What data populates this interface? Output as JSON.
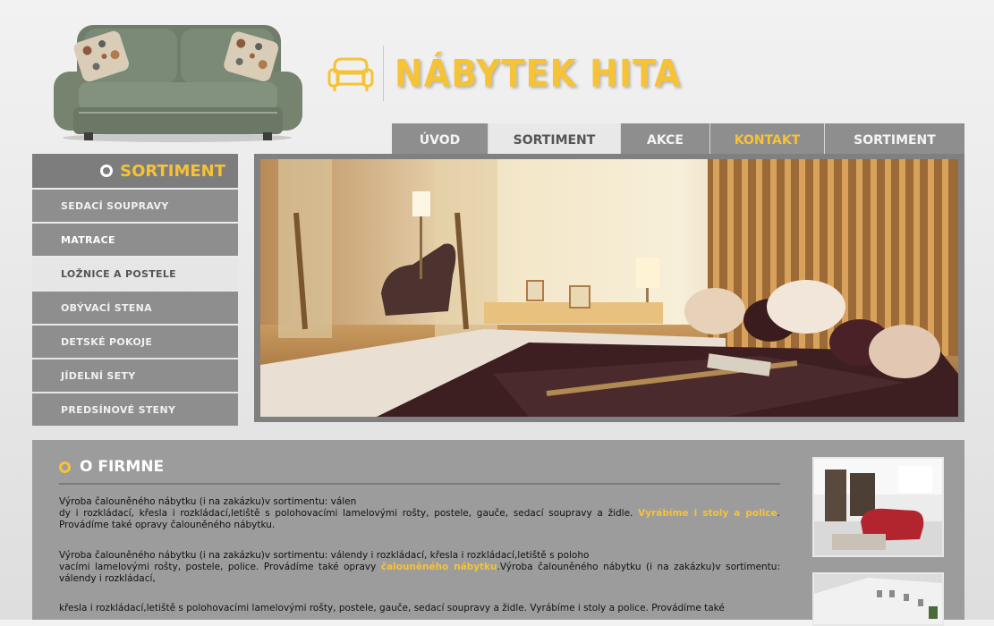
{
  "header": {
    "logo_text": "NÁBYTEK HITA",
    "colors": {
      "accent": "#f6c236",
      "nav": "#8e8e8e",
      "panel": "#9c9c9c"
    }
  },
  "topnav": {
    "tabs": [
      {
        "label": "ÚVOD"
      },
      {
        "label": "SORTIMENT"
      },
      {
        "label": "AKCE"
      },
      {
        "label": "KONTAKT"
      },
      {
        "label": "SORTIMENT"
      }
    ]
  },
  "sidebar": {
    "title": "SORTIMENT",
    "items": [
      {
        "label": "SEDACÍ SOUPRAVY"
      },
      {
        "label": "MATRACE"
      },
      {
        "label": "LOŽNICE A POSTELE"
      },
      {
        "label": "OBÝVACÍ STENA"
      },
      {
        "label": "DETSKÉ POKOJE"
      },
      {
        "label": "JÍDELNÍ SETY"
      },
      {
        "label": "PREDSÍNOVÉ STENY"
      }
    ]
  },
  "about": {
    "title": "O FIRMNE",
    "p1_a": "Výroba čalouněného nábytku (i na zakázku)v sortimentu: válen",
    "p1_b": "dy i rozkládací, křesla i rozkládací,letiště s polohovacími lamelovými rošty, postele, gauče, sedací soupravy a židle. ",
    "p1_hl": "Vyrábíme i stoly a police",
    "p1_c": ". Provádíme také opravy čalouněného nábytku.",
    "p2_a": "Výroba čalouněného nábytku (i na zakázku)v sortimentu: válendy i rozkládací, křesla i rozkládací,letiště s poloho",
    "p2_b": "vacími lamelovými rošty, postele, police. Provádíme také opravy ",
    "p2_hl": "čalouněného nábytku",
    "p2_c": ".Výroba čalouněného nábytku (i na zakázku)v sortimentu: válendy i rozkládací,",
    "p3_a": "křesla i rozkládací,letiště s polohovacími lamelovými rošty, postele, gauče, sedací soupravy a židle. Vyrábíme i stoly a police. Provádíme také"
  }
}
